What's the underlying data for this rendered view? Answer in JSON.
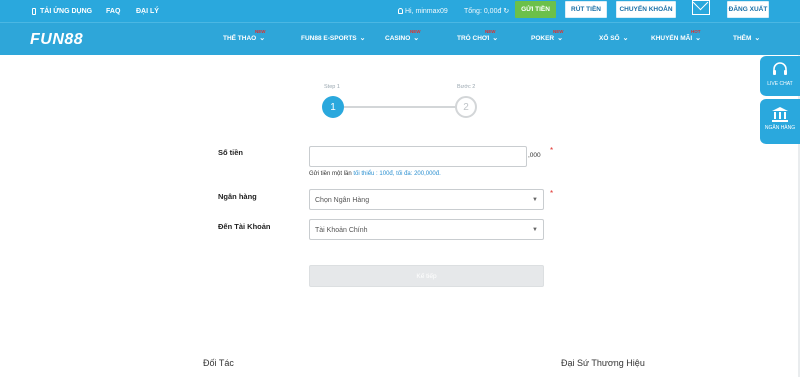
{
  "topbar": {
    "app_download": "TẢI ỨNG DỤNG",
    "faq": "FAQ",
    "agent": "ĐẠI LÝ",
    "greeting": "Hi, minmax09",
    "balance": "Tổng: 0,00đ",
    "deposit": "GỬI TIỀN",
    "withdraw": "RÚT TIỀN",
    "transfer": "CHUYỂN KHOẢN",
    "logout": "ĐĂNG XUẤT"
  },
  "nav": {
    "logo": "FUN88",
    "items": [
      {
        "label": "THỂ THAO",
        "badge": "NEW"
      },
      {
        "label": "FUN88 E-SPORTS",
        "badge": ""
      },
      {
        "label": "CASINO",
        "badge": "NEW"
      },
      {
        "label": "TRÒ CHƠI",
        "badge": "NEW"
      },
      {
        "label": "POKER",
        "badge": "NEW"
      },
      {
        "label": "XỔ SỐ",
        "badge": ""
      },
      {
        "label": "KHUYẾN MÃI",
        "badge": "HOT"
      },
      {
        "label": "THÊM",
        "badge": ""
      }
    ]
  },
  "steps": {
    "step1_label": "Step 1",
    "step1_number": "1",
    "step2_label": "Bước 2",
    "step2_number": "2"
  },
  "form": {
    "amount_label": "Số tiền",
    "amount_value": "",
    "amount_suffix": ",000",
    "hint_prefix": "Gửi tiền một lần ",
    "hint_limits": "tối thiểu : 100đ, tối đa: 200,000đ.",
    "bank_label": "Ngân hàng",
    "bank_selected": "Chọn Ngân Hàng",
    "account_label": "Đến Tài Khoản",
    "account_selected": "Tài Khoản Chính",
    "required_mark": "*",
    "next_button": "Kế tiếp"
  },
  "footer": {
    "partners": "Đối Tác",
    "ambassador": "Đại Sứ Thương Hiệu"
  },
  "side": {
    "live_chat": "LIVE CHAT",
    "bank": "NGÂN HÀNG"
  },
  "colors": {
    "brand_blue": "#2aa8dd",
    "deposit_green": "#6cc04a",
    "required_red": "#e0302c"
  },
  "icons": [
    "phone-icon",
    "user-icon",
    "refresh-icon",
    "mail-icon",
    "chevron-down-icon",
    "headset-icon",
    "bank-icon"
  ]
}
